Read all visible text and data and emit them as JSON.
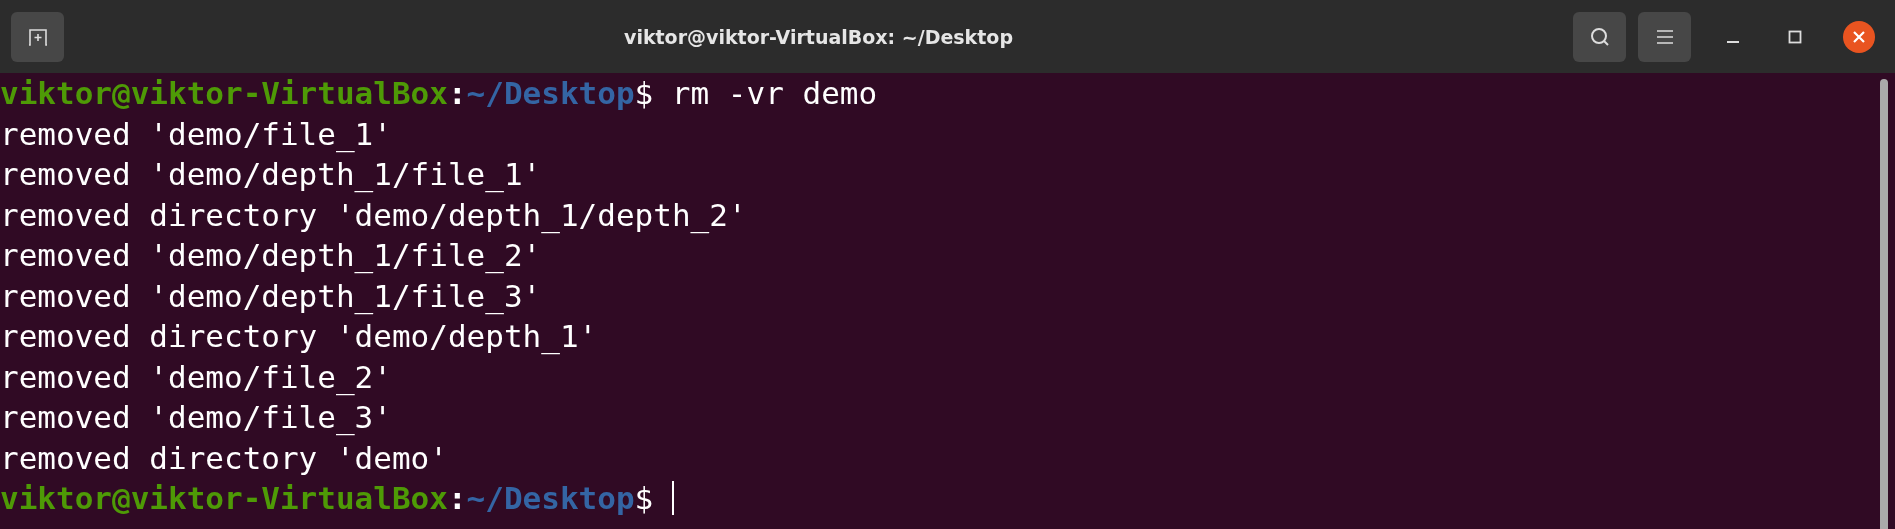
{
  "window": {
    "title": "viktor@viktor-VirtualBox: ~/Desktop"
  },
  "terminal": {
    "lines": [
      {
        "kind": "prompt",
        "user_host": "viktor@viktor-VirtualBox",
        "separator": ":",
        "path": "~/Desktop",
        "symbol": "$",
        "command": "rm -vr demo",
        "cursor": false
      },
      {
        "kind": "output",
        "text": "removed 'demo/file_1'"
      },
      {
        "kind": "output",
        "text": "removed 'demo/depth_1/file_1'"
      },
      {
        "kind": "output",
        "text": "removed directory 'demo/depth_1/depth_2'"
      },
      {
        "kind": "output",
        "text": "removed 'demo/depth_1/file_2'"
      },
      {
        "kind": "output",
        "text": "removed 'demo/depth_1/file_3'"
      },
      {
        "kind": "output",
        "text": "removed directory 'demo/depth_1'"
      },
      {
        "kind": "output",
        "text": "removed 'demo/file_2'"
      },
      {
        "kind": "output",
        "text": "removed 'demo/file_3'"
      },
      {
        "kind": "output",
        "text": "removed directory 'demo'"
      },
      {
        "kind": "prompt",
        "user_host": "viktor@viktor-VirtualBox",
        "separator": ":",
        "path": "~/Desktop",
        "symbol": "$",
        "cursor": true
      }
    ]
  }
}
